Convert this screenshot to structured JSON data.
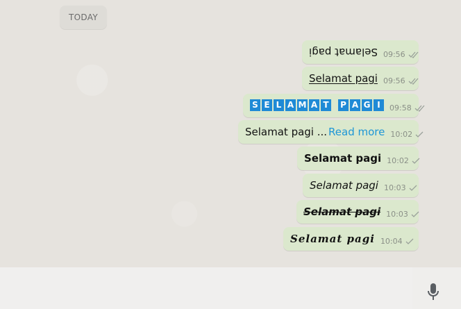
{
  "date_divider": {
    "label": "TODAY"
  },
  "messages": [
    {
      "text": "Selamat pagi",
      "time": "09:56",
      "status": "read",
      "style": "upside-down"
    },
    {
      "text": "Selamat pagi",
      "time": "09:56",
      "status": "read",
      "style": "underline"
    },
    {
      "text": "SELAMAT PAGI",
      "time": "09:58",
      "status": "read",
      "style": "boxed-letters"
    },
    {
      "text": "Selamat pagi ...",
      "link": "Read more",
      "time": "10:02",
      "status": "sent",
      "style": "plain"
    },
    {
      "text": "Selamat pagi",
      "time": "10:02",
      "status": "sent",
      "style": "bold"
    },
    {
      "text": "Selamat pagi",
      "time": "10:03",
      "status": "sent",
      "style": "italic"
    },
    {
      "text": "Selamat pagi",
      "time": "10:03",
      "status": "sent",
      "style": "bold-italic-strikethrough"
    },
    {
      "text": "Selamat pagi",
      "time": "10:04",
      "status": "sent",
      "style": "script"
    }
  ],
  "composer": {
    "placeholder": "",
    "mic_icon": "microphone-icon"
  },
  "colors": {
    "outgoing_bubble": "#dbe8cd",
    "link": "#1e96d6",
    "boxed_letter_bg": "#1f8ad6"
  }
}
